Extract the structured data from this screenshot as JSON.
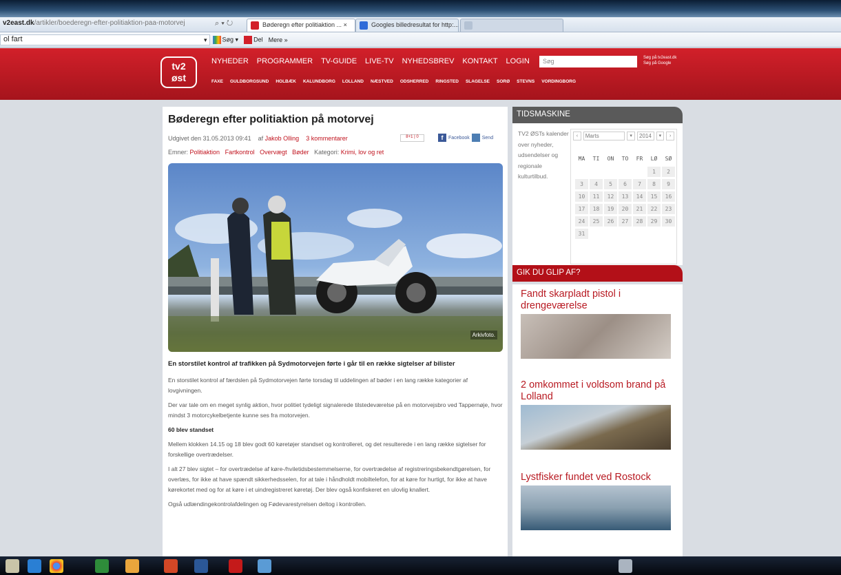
{
  "browser": {
    "url_domain": "v2east.dk",
    "url_path": "/artikler/boederegn-efter-politiaktion-paa-motorvej",
    "tabs": [
      {
        "label": "Bøderegn efter politiaktion ...  ×"
      },
      {
        "label": "Googles billedresultat for http:..."
      },
      {
        "label": ""
      }
    ],
    "search_value": "ol fart",
    "commands": {
      "search": "Søg",
      "share": "Del",
      "more": "Mere »"
    }
  },
  "site": {
    "logo_line1": "tv2",
    "logo_line2": "øst",
    "nav": [
      "NYHEDER",
      "PROGRAMMER",
      "TV-GUIDE",
      "LIVE-TV",
      "NYHEDSBREV",
      "KONTAKT",
      "LOGIN"
    ],
    "search_placeholder": "Søg",
    "search_link1": "Søg på tv2east.dk",
    "search_link2": "Søg på Google",
    "subnav": [
      "FAXE",
      "GULDBORGSUND",
      "HOLBÆK",
      "KALUNDBORG",
      "LOLLAND",
      "NÆSTVED",
      "ODSHERRED",
      "RINGSTED",
      "SLAGELSE",
      "SORØ",
      "STEVNS",
      "VORDINGBORG"
    ]
  },
  "article": {
    "title": "Bøderegn efter politiaktion på motorvej",
    "published": "Udgivet den 31.05.2013 09:41",
    "by": "af",
    "author": "Jakob Olling",
    "comments": "3 kommentarer",
    "facebook": "Facebook",
    "send": "Send",
    "topics_label": "Emner:",
    "topics": [
      "Politiaktion",
      "Fartkontrol",
      "Overvægt",
      "Bøder"
    ],
    "category_label": "Kategori:",
    "category": "Krimi, lov og ret",
    "photo_caption": "Arkivfoto.",
    "lead": "En storstilet kontrol af trafikken på Sydmotorvejen førte i går til en række sigtelser af bilister",
    "p1": "En storstilet kontrol af færdslen på Sydmotorvejen førte torsdag til uddelingen af bøder i en lang række kategorier af lovgivningen.",
    "p2": "Der var tale om en meget synlig aktion, hvor politiet tydeligt signalerede tilstedeværelse på en motorvejsbro ved Tappernøje, hvor mindst 3 motorcykelbetjente kunne ses fra motorvejen.",
    "subhead": "60 blev standset",
    "p3": "Mellem klokken 14.15 og 18 blev godt 60 køretøjer standset og kontrolleret, og det resulterede i en lang række sigtelser for forskellige overtrædelser.",
    "p4": "I alt 27 blev sigtet – for overtrædelse af køre-/hviletidsbestemmelserne, for overtrædelse af registreringsbekendtgørelsen, for overlæs, for ikke at have spændt sikkerhedsselen, for at tale i håndholdt mobiltelefon, for at køre for hurtigt, for ikke at have kørekortet med og for at køre i et uindregistreret køretøj. Der blev også konfiskeret en ulovlig knallert.",
    "p5": "Også udlændingekontrolafdelingen og Fødevarestyrelsen deltog i kontrollen."
  },
  "timemachine": {
    "heading": "TIDSMASKINE",
    "text": "TV2 ØSTs kalender over nyheder, udsendelser og regionale kulturtilbud.",
    "month": "Marts",
    "year": "2014",
    "weekdays": [
      "MA",
      "TI",
      "ON",
      "TO",
      "FR",
      "LØ",
      "SØ"
    ]
  },
  "missed": {
    "heading": "GIK DU GLIP AF?",
    "items": [
      {
        "title": "Fandt skarpladt pistol i drengeværelse"
      },
      {
        "title": "2 omkommet i voldsom brand på Lolland"
      },
      {
        "title": "Lystfisker fundet ved Rostock"
      }
    ]
  }
}
